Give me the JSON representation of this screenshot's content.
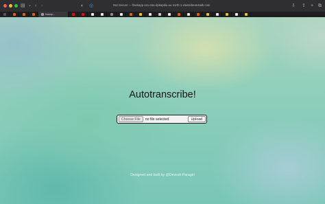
{
  "browser": {
    "address_text": "Not Secure — flaskapp-env.eba-dpkapdiu.au-north-1.elasticbeanstalk.com",
    "tabs": [
      {
        "title": "",
        "icon": "dark-tab-icon",
        "color": "#555555"
      },
      {
        "title": "",
        "icon": "firefox-icon",
        "color": "#e66000"
      },
      {
        "title": "",
        "icon": "firefox-icon",
        "color": "#e66000"
      },
      {
        "title": "",
        "icon": "firefox-icon",
        "color": "#e66000"
      },
      {
        "title": "flaskap...",
        "icon": "page-icon",
        "color": "#9a9aa0",
        "active": true
      },
      {
        "title": "",
        "icon": "youtube-icon",
        "color": "#ff0000"
      },
      {
        "title": "",
        "icon": "youtube-icon",
        "color": "#ff0000"
      },
      {
        "title": "",
        "icon": "tab-icon",
        "color": "#e8e8e8"
      },
      {
        "title": "",
        "icon": "tab-icon",
        "color": "#e8e8e8"
      },
      {
        "title": "",
        "icon": "tab-icon",
        "color": "#8a8a8a"
      },
      {
        "title": "",
        "icon": "tab-icon",
        "color": "#e8e8e8"
      },
      {
        "title": "",
        "icon": "tab-icon",
        "color": "#e66000"
      },
      {
        "title": "",
        "icon": "tab-icon",
        "color": "#f1c40f"
      },
      {
        "title": "",
        "icon": "tab-icon",
        "color": "#e8e8e8"
      },
      {
        "title": "",
        "icon": "tab-icon",
        "color": "#cccccc"
      },
      {
        "title": "",
        "icon": "tab-icon",
        "color": "#e8e8e8"
      },
      {
        "title": "",
        "icon": "tab-icon",
        "color": "#e66000"
      },
      {
        "title": "",
        "icon": "tab-icon",
        "color": "#e8e8e8"
      },
      {
        "title": "",
        "icon": "tab-icon",
        "color": "#e66000"
      },
      {
        "title": "",
        "icon": "tab-icon",
        "color": "#f1c40f"
      },
      {
        "title": "",
        "icon": "tab-icon",
        "color": "#e8e8e8"
      },
      {
        "title": "",
        "icon": "tab-icon",
        "color": "#f1c40f"
      },
      {
        "title": "",
        "icon": "tab-icon",
        "color": "#e8e8e8"
      },
      {
        "title": "",
        "icon": "tab-icon",
        "color": "#f1c40f"
      }
    ]
  },
  "page": {
    "title": "Autotranscribe!",
    "choose_file_label": "Choose File",
    "file_status": "no file selected",
    "upload_label": "Upload",
    "footer": "Designed and built by @Devesh Paragiri"
  }
}
